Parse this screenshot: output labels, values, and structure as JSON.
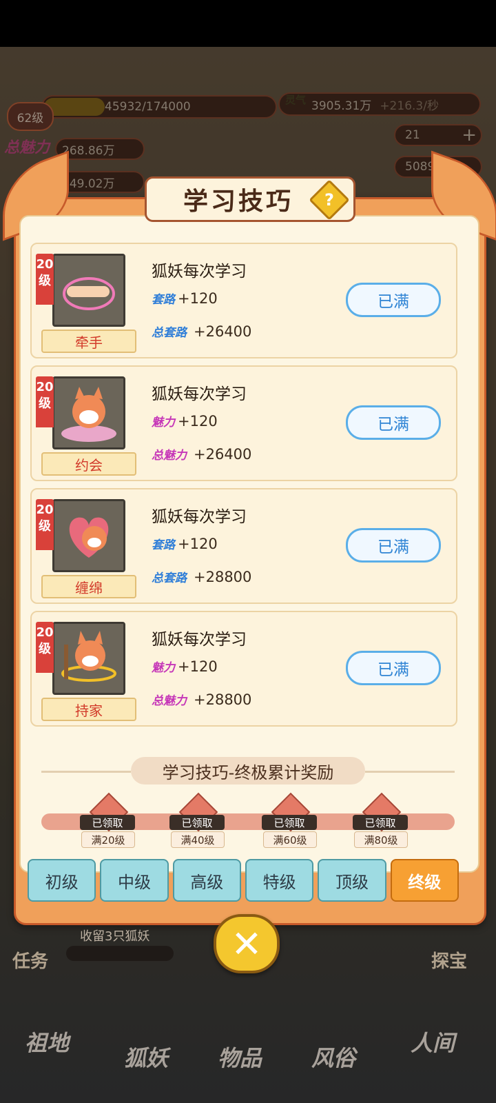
{
  "hud": {
    "level": "62级",
    "exp_text": "45932/174000",
    "exp_fraction": 0.264,
    "qi_label": "灵气",
    "qi_value": "3905.31万",
    "qi_rate": "+216.3/秒",
    "charm_label": "总魅力",
    "charm_value": "268.86万",
    "route_value": "249.02万",
    "item_count": "21",
    "red_count": "5089"
  },
  "panel": {
    "title": "学习技巧",
    "help": "?"
  },
  "skills": [
    {
      "level": "20级",
      "name": "牵手",
      "desc": "狐妖每次学习",
      "attr_icon": "套路",
      "attr_value": "+120",
      "total_icon": "总套路",
      "total_value": "+26400",
      "status": "已满",
      "color": "blue"
    },
    {
      "level": "20级",
      "name": "约会",
      "desc": "狐妖每次学习",
      "attr_icon": "魅力",
      "attr_value": "+120",
      "total_icon": "总魅力",
      "total_value": "+26400",
      "status": "已满",
      "color": "pink"
    },
    {
      "level": "20级",
      "name": "缠绵",
      "desc": "狐妖每次学习",
      "attr_icon": "套路",
      "attr_value": "+120",
      "total_icon": "总套路",
      "total_value": "+28800",
      "status": "已满",
      "color": "blue"
    },
    {
      "level": "20级",
      "name": "持家",
      "desc": "狐妖每次学习",
      "attr_icon": "魅力",
      "attr_value": "+120",
      "total_icon": "总魅力",
      "total_value": "+28800",
      "status": "已满",
      "color": "pink"
    }
  ],
  "reward": {
    "title": "学习技巧-终极累计奖励",
    "nodes": [
      {
        "tag": "已领取",
        "need": "满20级"
      },
      {
        "tag": "已领取",
        "need": "满40级"
      },
      {
        "tag": "已领取",
        "need": "满60级"
      },
      {
        "tag": "已领取",
        "need": "满80级"
      }
    ]
  },
  "tabs": [
    {
      "label": "初级",
      "active": false
    },
    {
      "label": "中级",
      "active": false
    },
    {
      "label": "高级",
      "active": false
    },
    {
      "label": "特级",
      "active": false
    },
    {
      "label": "顶级",
      "active": false
    },
    {
      "label": "终级",
      "active": true
    }
  ],
  "background": {
    "task_text": "收留3只狐妖",
    "task_label": "任务",
    "right_label": "探宝",
    "nav": [
      "祖地",
      "狐妖",
      "物品",
      "风俗",
      "人间"
    ]
  },
  "colors": {
    "accent": "#f7a033",
    "max_button": "#2f84d4",
    "name_text": "#d23a2a"
  }
}
